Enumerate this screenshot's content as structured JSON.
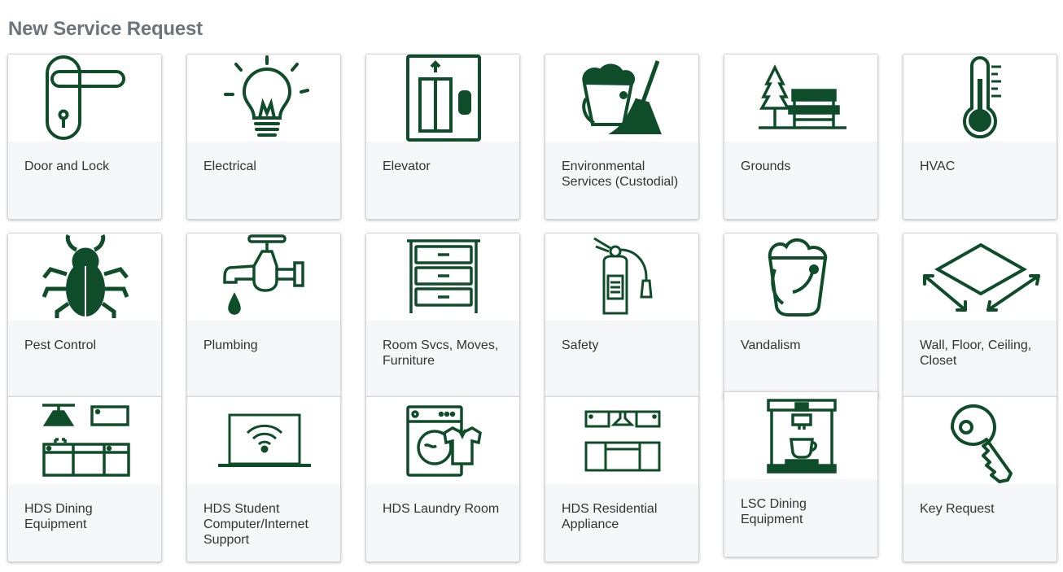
{
  "page": {
    "title": "New Service Request"
  },
  "theme": {
    "icon_color": "#0f4d2a",
    "card_bg": "#f6f7f9",
    "title_color": "#6c757d"
  },
  "cards": [
    {
      "label": "Door and Lock",
      "icon": "door-handle-icon"
    },
    {
      "label": "Electrical",
      "icon": "light-bulb-icon"
    },
    {
      "label": "Elevator",
      "icon": "elevator-icon"
    },
    {
      "label": "Environmental Services (Custodial)",
      "icon": "bucket-broom-icon"
    },
    {
      "label": "Grounds",
      "icon": "tree-bench-icon"
    },
    {
      "label": "HVAC",
      "icon": "thermometer-icon"
    },
    {
      "label": "Pest Control",
      "icon": "bug-icon"
    },
    {
      "label": "Plumbing",
      "icon": "faucet-icon"
    },
    {
      "label": "Room Svcs, Moves, Furniture",
      "icon": "dresser-icon"
    },
    {
      "label": "Safety",
      "icon": "fire-extinguisher-icon"
    },
    {
      "label": "Vandalism",
      "icon": "paint-bucket-icon"
    },
    {
      "label": "Wall, Floor, Ceiling, Closet",
      "icon": "floor-area-icon"
    },
    {
      "label": "HDS Dining Equipment",
      "icon": "kitchen-equipment-icon"
    },
    {
      "label": "HDS Student Computer/Internet Support",
      "icon": "laptop-wifi-icon"
    },
    {
      "label": "HDS Laundry Room",
      "icon": "washing-machine-icon"
    },
    {
      "label": "HDS Residential Appliance",
      "icon": "kitchen-appliance-icon"
    },
    {
      "label": "LSC Dining Equipment",
      "icon": "coffee-machine-icon"
    },
    {
      "label": "Key Request",
      "icon": "key-icon"
    }
  ]
}
